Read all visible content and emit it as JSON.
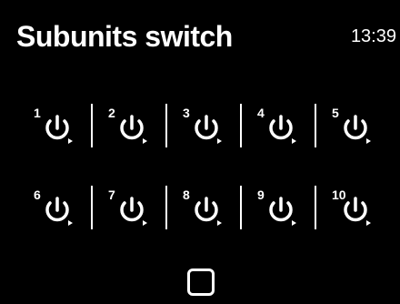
{
  "header": {
    "title": "Subunits switch",
    "time": "13:39"
  },
  "subunits": [
    {
      "label": "1",
      "icon": "power-icon"
    },
    {
      "label": "2",
      "icon": "power-icon"
    },
    {
      "label": "3",
      "icon": "power-icon"
    },
    {
      "label": "4",
      "icon": "power-icon"
    },
    {
      "label": "5",
      "icon": "power-icon"
    },
    {
      "label": "6",
      "icon": "power-icon"
    },
    {
      "label": "7",
      "icon": "power-icon"
    },
    {
      "label": "8",
      "icon": "power-icon"
    },
    {
      "label": "9",
      "icon": "power-icon"
    },
    {
      "label": "10",
      "icon": "power-icon"
    }
  ],
  "footer": {
    "button_icon": "stop-square-icon"
  },
  "colors": {
    "background": "#000000",
    "foreground": "#ffffff"
  }
}
